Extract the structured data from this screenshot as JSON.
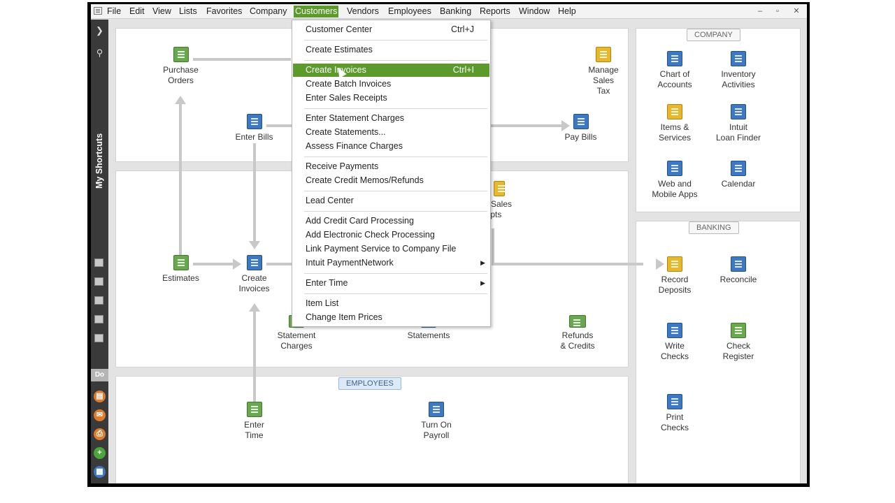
{
  "menubar": {
    "items": [
      "File",
      "Edit",
      "View",
      "Lists",
      "Favorites",
      "Company",
      "Customers",
      "Vendors",
      "Employees",
      "Banking",
      "Reports",
      "Window",
      "Help"
    ],
    "active": "Customers",
    "window_controls": [
      "–",
      "▫",
      "✕"
    ]
  },
  "sidebar": {
    "title": "My Shortcuts",
    "do_label": "Do"
  },
  "customers_menu": {
    "items": [
      {
        "label": "Customer Center",
        "shortcut": "Ctrl+J"
      },
      {
        "label": "Create Estimates"
      },
      {
        "label": "Create Invoices",
        "shortcut": "Ctrl+I",
        "highlighted": true
      },
      {
        "label": "Create Batch Invoices"
      },
      {
        "label": "Enter Sales Receipts"
      },
      {
        "label": "Enter Statement Charges"
      },
      {
        "label": "Create Statements..."
      },
      {
        "label": "Assess Finance Charges"
      },
      {
        "label": "Receive Payments"
      },
      {
        "label": "Create Credit Memos/Refunds"
      },
      {
        "label": "Lead Center"
      },
      {
        "label": "Add Credit Card Processing"
      },
      {
        "label": "Add Electronic Check Processing"
      },
      {
        "label": "Link Payment Service to Company File"
      },
      {
        "label": "Intuit PaymentNetwork",
        "submenu": true
      },
      {
        "label": "Enter Time",
        "submenu": true
      },
      {
        "label": "Item List"
      },
      {
        "label": "Change Item Prices"
      }
    ]
  },
  "vendors_flow": {
    "purchase_orders": "Purchase\nOrders",
    "enter_bills": "Enter Bills",
    "manage_sales_tax": "Manage\nSales\nTax",
    "pay_bills": "Pay Bills"
  },
  "customers_flow": {
    "estimates": "Estimates",
    "create_invoices": "Create\nInvoices",
    "sales_receipts_partial": "e Sales\neipts",
    "statement_charges": "Statement\nCharges",
    "statements": "Statements",
    "refunds_credits": "Refunds\n& Credits"
  },
  "employees": {
    "tab": "EMPLOYEES",
    "enter_time": "Enter\nTime",
    "turn_on_payroll": "Turn On\nPayroll"
  },
  "company": {
    "tab": "COMPANY",
    "items": [
      "Chart of\nAccounts",
      "Inventory\nActivities",
      "Items &\nServices",
      "Intuit\nLoan Finder",
      "Web and\nMobile Apps",
      "Calendar"
    ]
  },
  "banking": {
    "tab": "BANKING",
    "items": [
      "Record\nDeposits",
      "Reconcile",
      "Write\nChecks",
      "Check\nRegister",
      "Print\nChecks"
    ]
  },
  "colors": {
    "menu_highlight": "#5d9a2c",
    "sidebar_bg": "#3a3a3a",
    "arrow": "#c8c8c8",
    "employees_tab": "#dce9f7"
  }
}
